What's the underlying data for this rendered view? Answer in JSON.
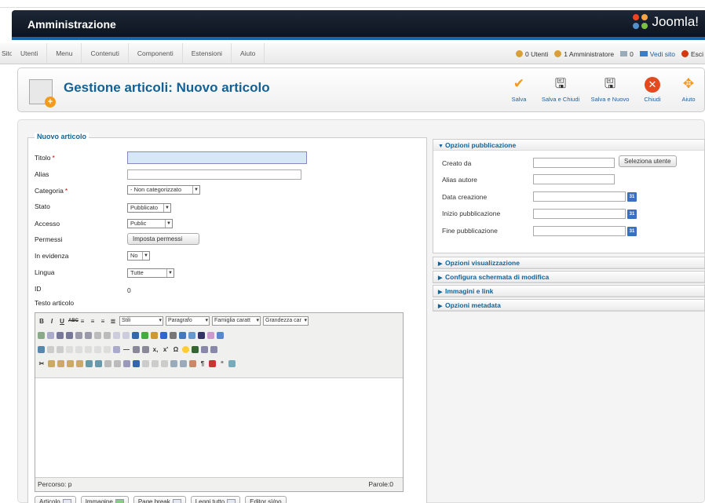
{
  "header": {
    "title": "Amministrazione",
    "logo": "Joomla!"
  },
  "menu": {
    "items": [
      "Sito",
      "Utenti",
      "Menu",
      "Contenuti",
      "Componenti",
      "Estensioni",
      "Aiuto"
    ]
  },
  "status": {
    "users": "0 Utenti",
    "admins": "1 Amministratore",
    "messages": "0",
    "view_site": "Vedi sito",
    "logout": "Esci"
  },
  "toolbar": {
    "title": "Gestione articoli: Nuovo articolo",
    "buttons": [
      "Salva",
      "Salva e Chiudi",
      "Salva e Nuovo",
      "Chiudi",
      "Aiuto"
    ]
  },
  "form": {
    "legend": "Nuovo articolo",
    "labels": {
      "title": "Titolo",
      "alias": "Alias",
      "category": "Categoria",
      "state": "Stato",
      "access": "Accesso",
      "permissions": "Permessi",
      "featured": "In evidenza",
      "language": "Lingua",
      "id": "ID",
      "text": "Testo articolo"
    },
    "required_mark": "*",
    "category_value": "- Non categorizzato",
    "state_value": "Pubblicato",
    "access_value": "Public",
    "permissions_button": "Imposta permessi",
    "featured_value": "No",
    "language_value": "Tutte",
    "id_value": "0"
  },
  "editor": {
    "styles_select": "Stili",
    "format_select": "Paragrafo",
    "font_select": "Famiglia caratt",
    "size_select": "Grandezza car",
    "path": "Percorso: p",
    "word_count": "Parole:0"
  },
  "editor_buttons": [
    "Articolo",
    "Immagine",
    "Page break",
    "Leggi tutto",
    "Editor sì/no"
  ],
  "options": {
    "publishing": "Opzioni pubblicazione",
    "created_by": "Creato da",
    "select_user": "Seleziona utente",
    "author_alias": "Alias autore",
    "created_date": "Data creazione",
    "publish_up": "Inizio pubblicazione",
    "publish_down": "Fine pubblicazione",
    "calendar_label": "31",
    "display": "Opzioni visualizzazione",
    "edit_screen": "Configura schermata di modifica",
    "images": "Immagini e link",
    "metadata": "Opzioni metadata"
  },
  "colors": {
    "accent": "#146295",
    "header_bg": "#111a28",
    "header_border": "#1b64a4"
  }
}
